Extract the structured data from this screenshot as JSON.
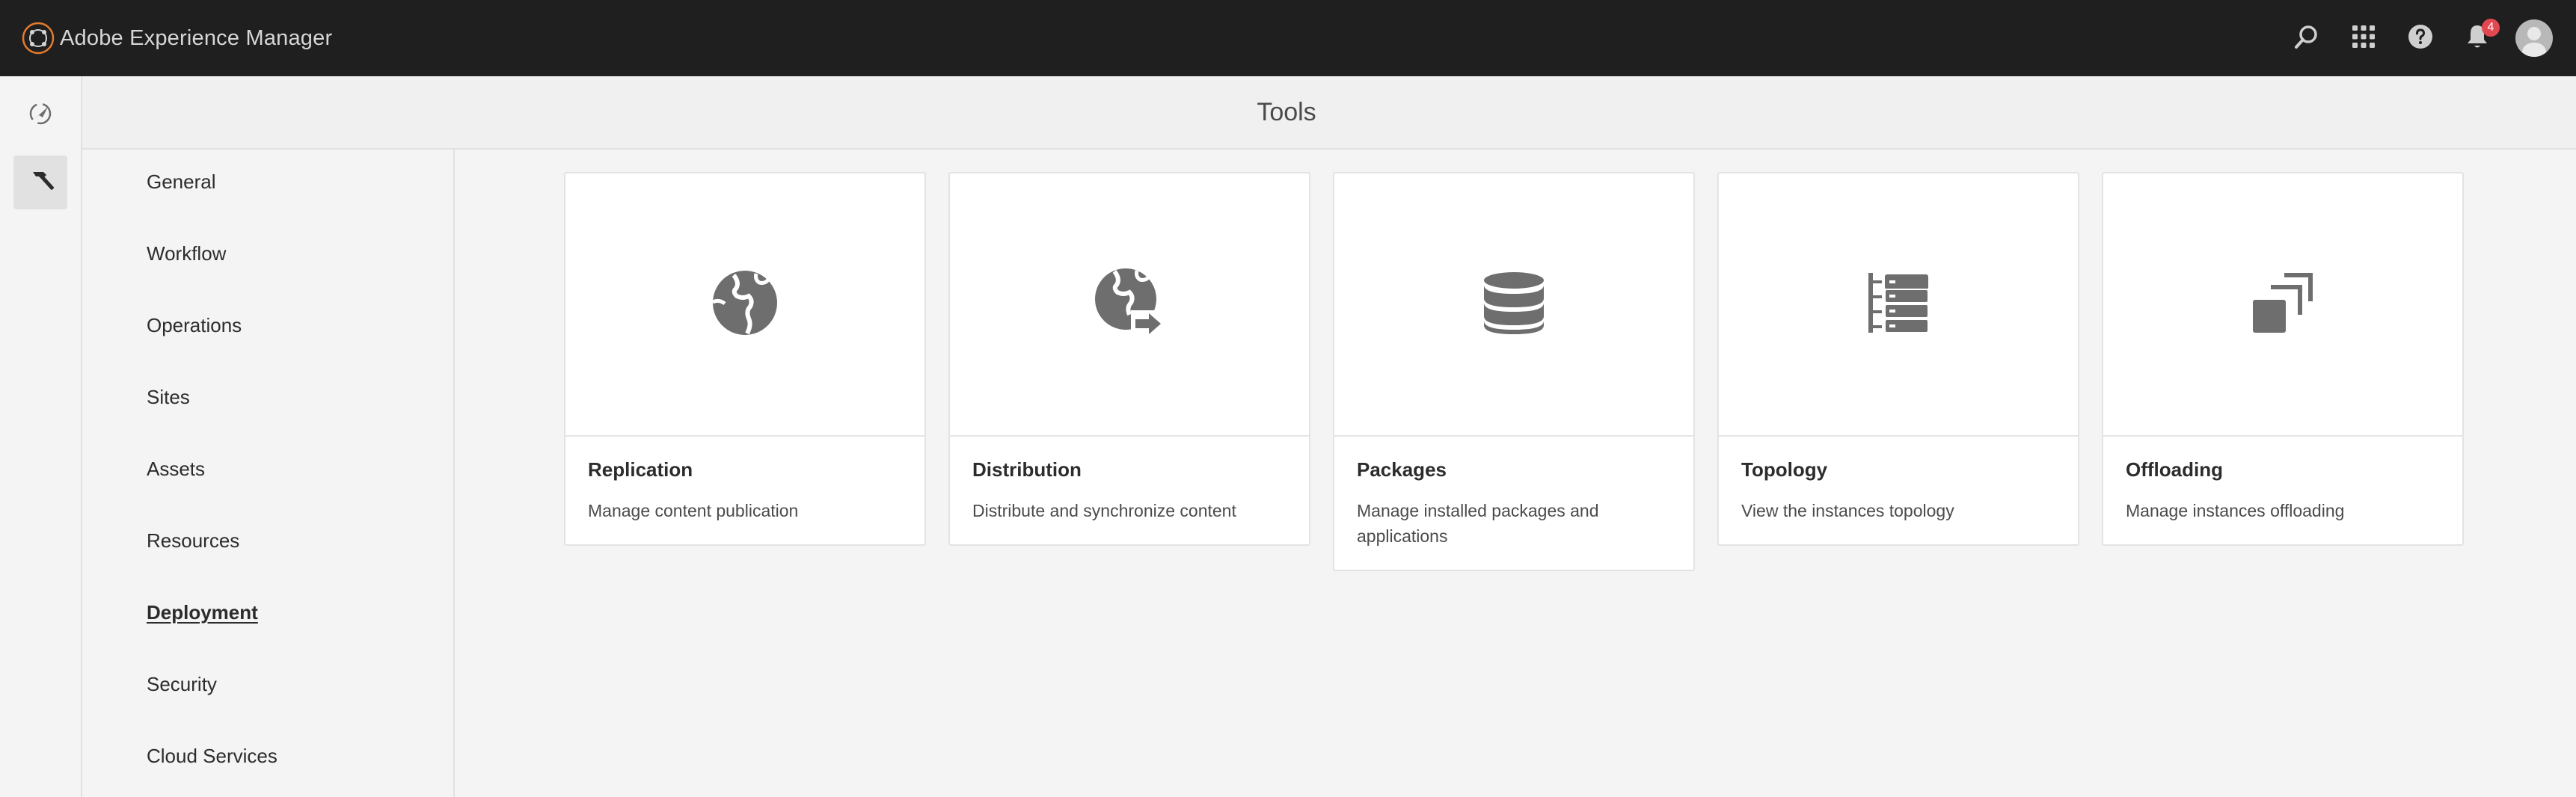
{
  "header": {
    "app_title": "Adobe Experience Manager",
    "notification_count": "4",
    "icons": [
      "adobe-logo-icon",
      "search-icon",
      "apps-grid-icon",
      "help-icon",
      "bell-icon",
      "user-avatar-icon"
    ]
  },
  "rail": {
    "items": [
      {
        "icon": "navigation-icon",
        "active": false
      },
      {
        "icon": "hammer-icon",
        "active": true
      }
    ]
  },
  "page": {
    "title": "Tools"
  },
  "categories": {
    "items": [
      {
        "label": "General"
      },
      {
        "label": "Workflow"
      },
      {
        "label": "Operations"
      },
      {
        "label": "Sites"
      },
      {
        "label": "Assets"
      },
      {
        "label": "Resources"
      },
      {
        "label": "Deployment",
        "selected": true
      },
      {
        "label": "Security"
      },
      {
        "label": "Cloud Services"
      }
    ]
  },
  "cards": [
    {
      "title": "Replication",
      "description": "Manage content publication",
      "icon": "globe-icon"
    },
    {
      "title": "Distribution",
      "description": "Distribute and synchronize content",
      "icon": "globe-arrow-icon"
    },
    {
      "title": "Packages",
      "description": "Manage installed packages and applications",
      "icon": "database-icon"
    },
    {
      "title": "Topology",
      "description": "View the instances topology",
      "icon": "tree-view-icon"
    },
    {
      "title": "Offloading",
      "description": "Manage instances offloading",
      "icon": "copy-stack-icon"
    }
  ],
  "colors": {
    "shell_bg": "#1f1f1f",
    "brand_accent": "#e37b2d",
    "badge": "#e34850",
    "icon_gray": "#6e6e6e",
    "page_bg": "#f4f4f4"
  }
}
